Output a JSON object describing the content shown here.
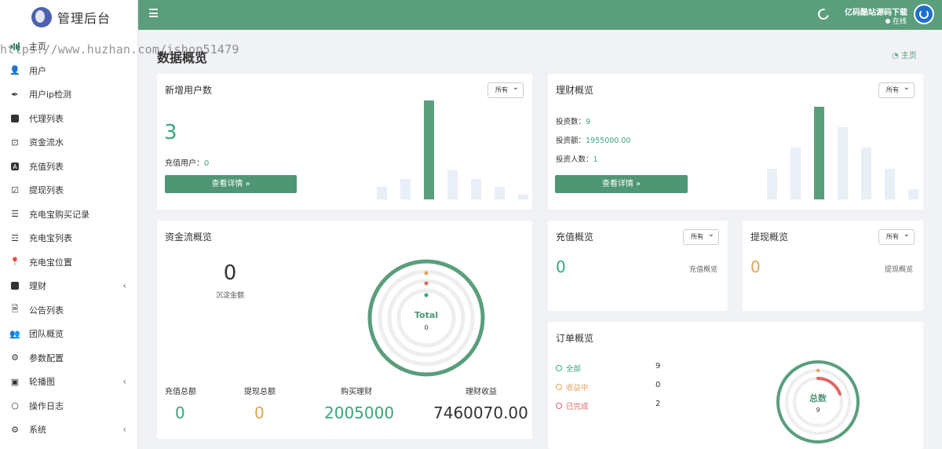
{
  "brand": {
    "title": "管理后台"
  },
  "watermark": "https://www.huzhan.com/ishop51479",
  "sidebar": {
    "items": [
      {
        "label": "主页",
        "icon": "bar-chart-icon"
      },
      {
        "label": "用户",
        "icon": "user-icon"
      },
      {
        "label": "用户ip检测",
        "icon": "feather-icon"
      },
      {
        "label": "代理列表",
        "icon": "id-card-icon"
      },
      {
        "label": "资金流水",
        "icon": "money-icon"
      },
      {
        "label": "充值列表",
        "icon": "font-box-icon"
      },
      {
        "label": "提现列表",
        "icon": "check-square-icon"
      },
      {
        "label": "充电宝购买记录",
        "icon": "list-icon"
      },
      {
        "label": "充电宝列表",
        "icon": "indent-list-icon"
      },
      {
        "label": "充电宝位置",
        "icon": "map-pin-icon"
      },
      {
        "label": "理财",
        "icon": "archive-icon"
      },
      {
        "label": "公告列表",
        "icon": "file-icon"
      },
      {
        "label": "团队概览",
        "icon": "users-icon"
      },
      {
        "label": "参数配置",
        "icon": "cogs-icon"
      },
      {
        "label": "轮播图",
        "icon": "image-icon"
      },
      {
        "label": "操作日志",
        "icon": "circle-icon"
      },
      {
        "label": "系统",
        "icon": "gear-icon"
      }
    ]
  },
  "header": {
    "user_name": "亿码酷站源码下载",
    "status": "在线"
  },
  "page": {
    "title": "数据概览",
    "breadcrumb": "主页"
  },
  "filter_option": "所有",
  "new_users": {
    "title": "新增用户数",
    "count": "3",
    "recharge_label": "充值用户：",
    "recharge_value": "0",
    "button": "查看详情 »"
  },
  "wealth": {
    "title": "理财概览",
    "invest_count_label": "投资数：",
    "invest_count": "9",
    "invest_amount_label": "投资额：",
    "invest_amount": "1955000.00",
    "investors_label": "投资人数：",
    "investors": "1",
    "button": "查看详情 »"
  },
  "funds": {
    "title": "资金流概览",
    "sediment_value": "0",
    "sediment_label": "沉淀金额",
    "ring_label": "Total",
    "ring_value": "0",
    "stats": [
      {
        "label": "充值总额",
        "value": "0"
      },
      {
        "label": "提现总额",
        "value": "0"
      },
      {
        "label": "购买理财",
        "value": "2005000"
      },
      {
        "label": "理财收益",
        "value": "7460070.00"
      }
    ]
  },
  "recharge": {
    "title": "充值概览",
    "value": "0",
    "caption": "充值概览"
  },
  "withdraw": {
    "title": "提现概览",
    "value": "0",
    "caption": "提现概览"
  },
  "orders": {
    "title": "订单概览",
    "ring_label": "总数",
    "ring_value": "9",
    "legend": [
      {
        "label": "全部",
        "value": "9"
      },
      {
        "label": "收益中",
        "value": "0"
      },
      {
        "label": "已完成",
        "value": "2"
      }
    ]
  },
  "colors": {
    "header": "#5a9e7c",
    "green": "#3aa67a",
    "orange": "#e0a35a",
    "red": "#e06666"
  }
}
